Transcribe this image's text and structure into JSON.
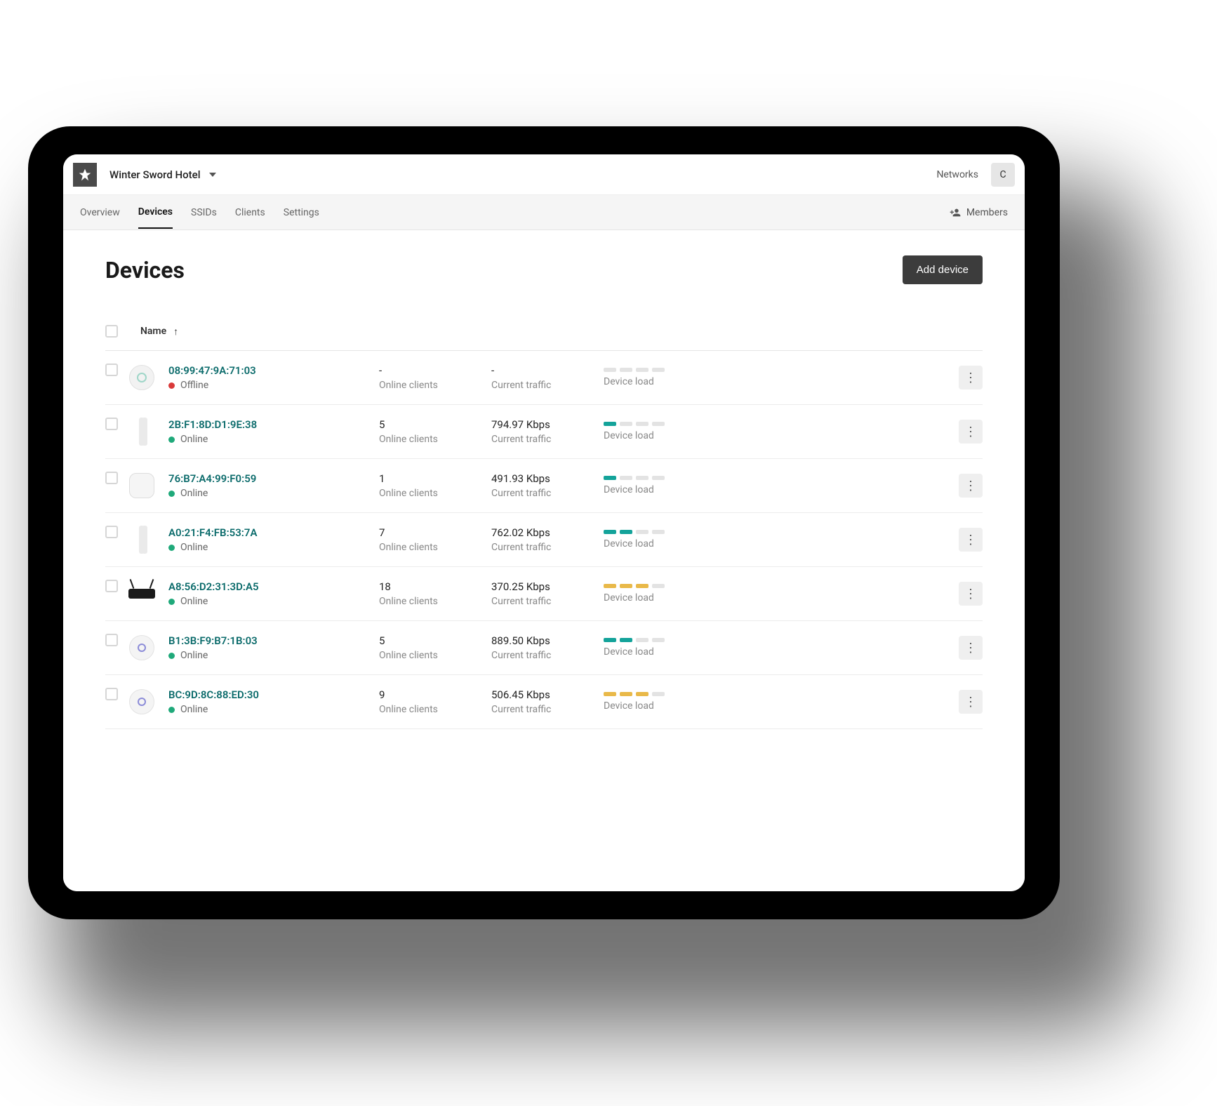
{
  "topbar": {
    "site_name": "Winter Sword Hotel",
    "networks_link": "Networks",
    "avatar_initial": "C"
  },
  "tabs": {
    "items": [
      "Overview",
      "Devices",
      "SSIDs",
      "Clients",
      "Settings"
    ],
    "active": "Devices",
    "members_label": "Members"
  },
  "page": {
    "title": "Devices",
    "add_button": "Add device"
  },
  "table": {
    "header_name": "Name",
    "labels": {
      "online_clients": "Online clients",
      "current_traffic": "Current traffic",
      "device_load": "Device load"
    },
    "rows": [
      {
        "mac": "08:99:47:9A:71:03",
        "status": "Offline",
        "status_kind": "offline",
        "clients": "-",
        "traffic": "-",
        "load_segments": 0,
        "load_color": "none",
        "thumb": "ap-round"
      },
      {
        "mac": "2B:F1:8D:D1:9E:38",
        "status": "Online",
        "status_kind": "online",
        "clients": "5",
        "traffic": "794.97 Kbps",
        "load_segments": 1,
        "load_color": "teal",
        "thumb": "stick"
      },
      {
        "mac": "76:B7:A4:99:F0:59",
        "status": "Online",
        "status_kind": "online",
        "clients": "1",
        "traffic": "491.93 Kbps",
        "load_segments": 1,
        "load_color": "teal",
        "thumb": "square"
      },
      {
        "mac": "A0:21:F4:FB:53:7A",
        "status": "Online",
        "status_kind": "online",
        "clients": "7",
        "traffic": "762.02 Kbps",
        "load_segments": 2,
        "load_color": "teal",
        "thumb": "stick"
      },
      {
        "mac": "A8:56:D2:31:3D:A5",
        "status": "Online",
        "status_kind": "online",
        "clients": "18",
        "traffic": "370.25 Kbps",
        "load_segments": 3,
        "load_color": "amber",
        "thumb": "router"
      },
      {
        "mac": "B1:3B:F9:B7:1B:03",
        "status": "Online",
        "status_kind": "online",
        "clients": "5",
        "traffic": "889.50 Kbps",
        "load_segments": 2,
        "load_color": "teal",
        "thumb": "disc"
      },
      {
        "mac": "BC:9D:8C:88:ED:30",
        "status": "Online",
        "status_kind": "online",
        "clients": "9",
        "traffic": "506.45 Kbps",
        "load_segments": 3,
        "load_color": "amber",
        "thumb": "disc"
      }
    ]
  }
}
